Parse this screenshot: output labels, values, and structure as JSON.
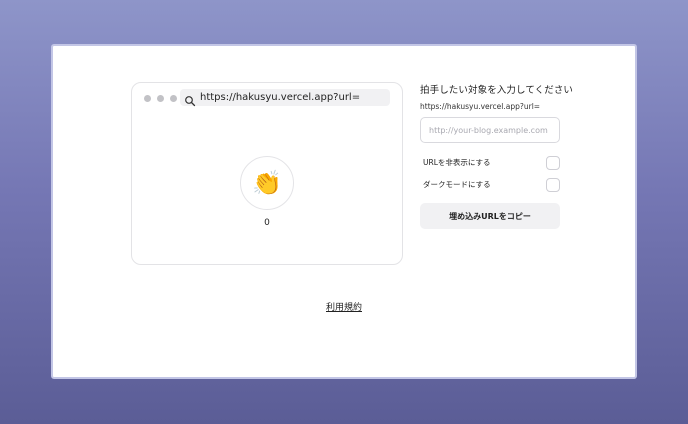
{
  "preview": {
    "address_url": "https://hakusyu.vercel.app?url=",
    "clap_emoji": "👏",
    "clap_count": "0"
  },
  "form": {
    "title": "拍手したい対象を入力してください",
    "url_prefix": "https://hakusyu.vercel.app?url=",
    "url_input_placeholder": "http://your-blog.example.com",
    "url_input_value": "",
    "hide_url_label": "URLを非表示にする",
    "hide_url_checked": false,
    "dark_mode_label": "ダークモードにする",
    "dark_mode_checked": false,
    "copy_button_label": "埋め込みURLをコピー"
  },
  "footer": {
    "terms_link": "利用規約"
  }
}
